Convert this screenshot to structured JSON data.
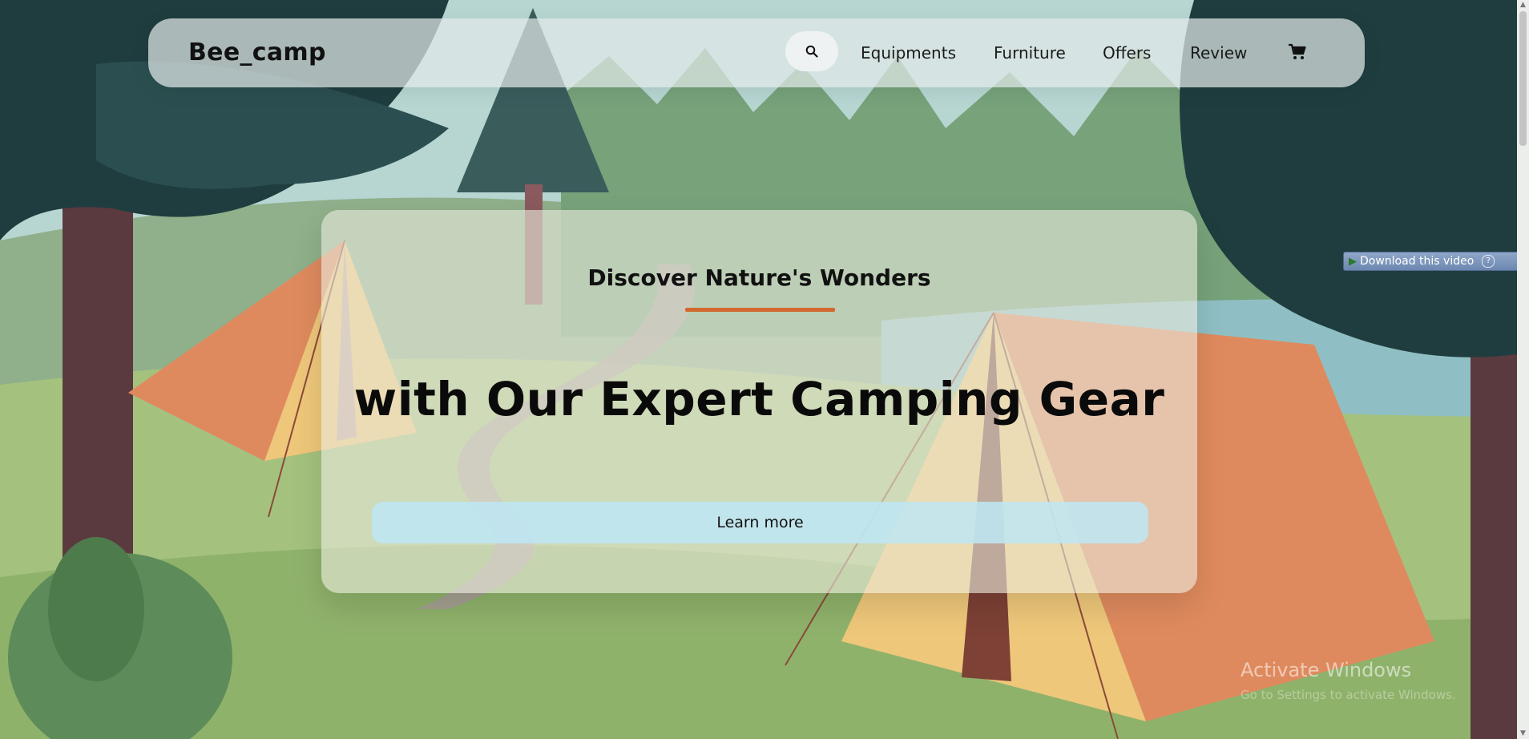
{
  "nav": {
    "brand": "Bee_camp",
    "links": [
      "Equipments",
      "Furniture",
      "Offers",
      "Review"
    ],
    "search_icon": "search-icon",
    "cart_icon": "cart-icon"
  },
  "hero": {
    "subtitle": "Discover Nature's Wonders",
    "headline": "with Our Expert Camping Gear",
    "cta_label": "Learn more"
  },
  "overlay": {
    "download_label": "Download this video",
    "help_label": "?",
    "watermark_title": "Activate Windows",
    "watermark_sub": "Go to Settings to activate Windows."
  },
  "colors": {
    "accent_underline": "#d0682f",
    "cta_bg": "#bfe6f2",
    "tent_orange": "#df8a5e",
    "tent_yellow": "#eec77a",
    "forest_dark": "#1f3d3f",
    "grass": "#9dbd7c"
  }
}
